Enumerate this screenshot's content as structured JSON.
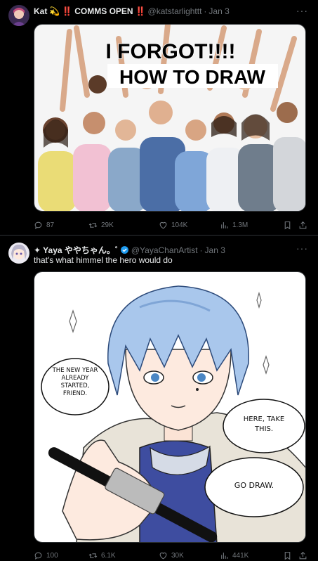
{
  "tweets": [
    {
      "display_name": "Kat",
      "name_emoji": "💫",
      "badge_pre": "‼️",
      "badge_text": "COMMS OPEN",
      "badge_post": "‼️",
      "handle": "@katstarlighttt",
      "date": "Jan 3",
      "image_text_line1": "I FORGOT!!!!",
      "image_text_line2": "HOW TO DRAW",
      "stats": {
        "replies": "87",
        "retweets": "29K",
        "likes": "104K",
        "views": "1.3M"
      }
    },
    {
      "display_name": "✦ Yaya ややちゃん。˚",
      "handle": "@YayaChanArtist",
      "date": "Jan 3",
      "text": "that's what himmel the hero would do",
      "bubble_left": "THE NEW YEAR ALREADY STARTED, FRIEND.",
      "bubble_right": "HERE, TAKE THIS.",
      "bubble_bottom": "GO DRAW.",
      "stats": {
        "replies": "100",
        "retweets": "6.1K",
        "likes": "30K",
        "views": "441K"
      }
    }
  ],
  "icons": {
    "reply": "reply-icon",
    "retweet": "retweet-icon",
    "like": "heart-icon",
    "views": "views-icon",
    "bookmark": "bookmark-icon",
    "share": "share-icon",
    "more": "more-icon",
    "verified": "verified-badge-icon"
  },
  "colors": {
    "background": "#000000",
    "text": "#e7e9ea",
    "muted": "#71767b",
    "border": "#2f3336",
    "verified": "#1d9bf0",
    "badge_red": "#f4212e"
  }
}
